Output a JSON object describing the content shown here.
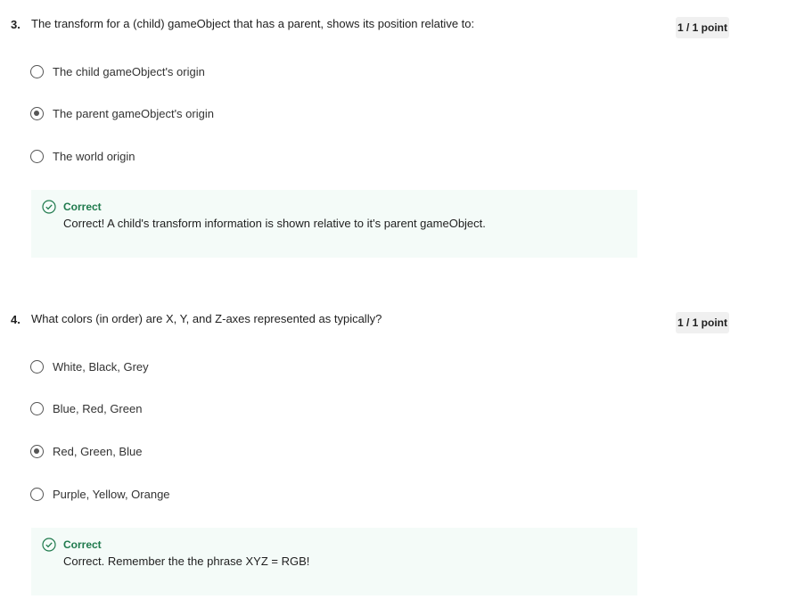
{
  "questions": [
    {
      "number": "3.",
      "prompt": "The transform for a (child) gameObject that has a parent, shows its position relative to:",
      "score": "1 / 1 point",
      "options": [
        {
          "label": "The child gameObject's origin",
          "selected": false
        },
        {
          "label": "The parent gameObject's origin",
          "selected": true
        },
        {
          "label": "The world origin",
          "selected": false
        }
      ],
      "feedback": {
        "status": "Correct",
        "message": "Correct! A child's transform information is shown relative to it's parent gameObject."
      }
    },
    {
      "number": "4.",
      "prompt": "What colors (in order) are X, Y, and Z-axes represented as typically?",
      "score": "1 / 1 point",
      "options": [
        {
          "label": "White, Black, Grey",
          "selected": false
        },
        {
          "label": "Blue, Red, Green",
          "selected": false
        },
        {
          "label": "Red, Green, Blue",
          "selected": true
        },
        {
          "label": "Purple, Yellow, Orange",
          "selected": false
        }
      ],
      "feedback": {
        "status": "Correct",
        "message": "Correct. Remember the the phrase XYZ = RGB!"
      }
    }
  ],
  "colors": {
    "correct_green": "#1f7a4d",
    "feedback_bg": "#f4fbf8",
    "badge_bg": "#f0f0f0",
    "radio_gray": "#555555"
  },
  "icons": {
    "feedback_icon": "check-circle-icon"
  }
}
